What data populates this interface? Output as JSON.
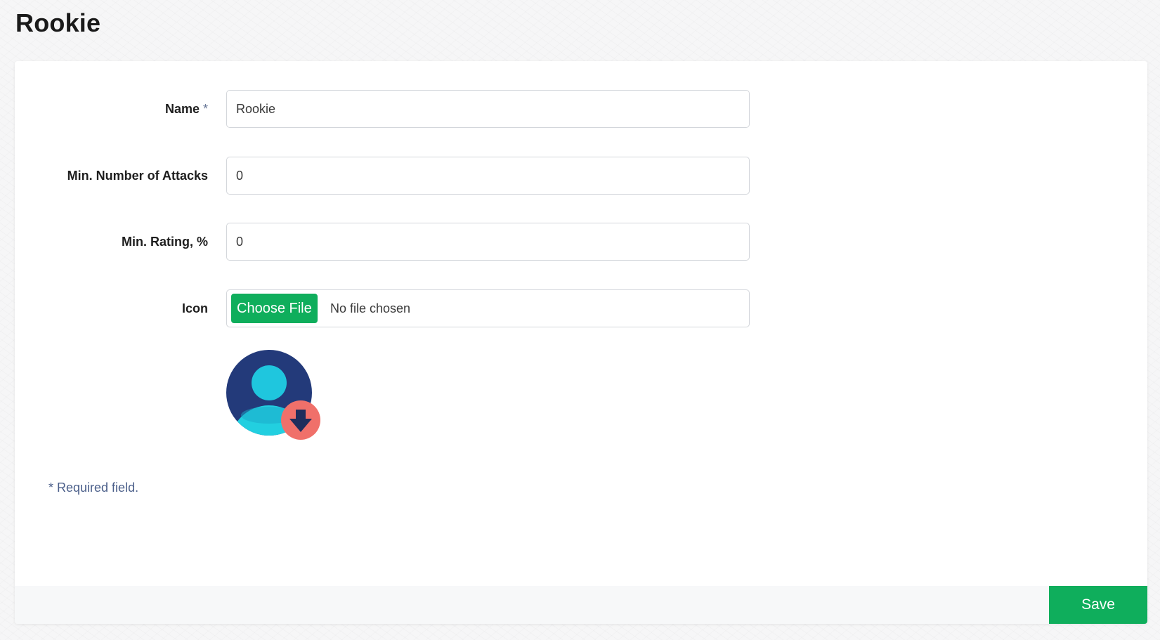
{
  "page": {
    "title": "Rookie"
  },
  "form": {
    "name": {
      "label": "Name",
      "required_mark": "*",
      "value": "Rookie"
    },
    "min_attacks": {
      "label": "Min. Number of Attacks",
      "value": "0"
    },
    "min_rating": {
      "label": "Min. Rating, %",
      "value": "0"
    },
    "icon": {
      "label": "Icon",
      "choose_label": "Choose File",
      "status": "No file chosen",
      "preview_icon": "user-download-icon"
    },
    "required_note": "* Required field."
  },
  "footer": {
    "save_label": "Save"
  },
  "colors": {
    "accent_green": "#0fae5c",
    "avatar_bg": "#233a7a",
    "avatar_figure": "#22cfe0",
    "badge": "#f0706a"
  }
}
